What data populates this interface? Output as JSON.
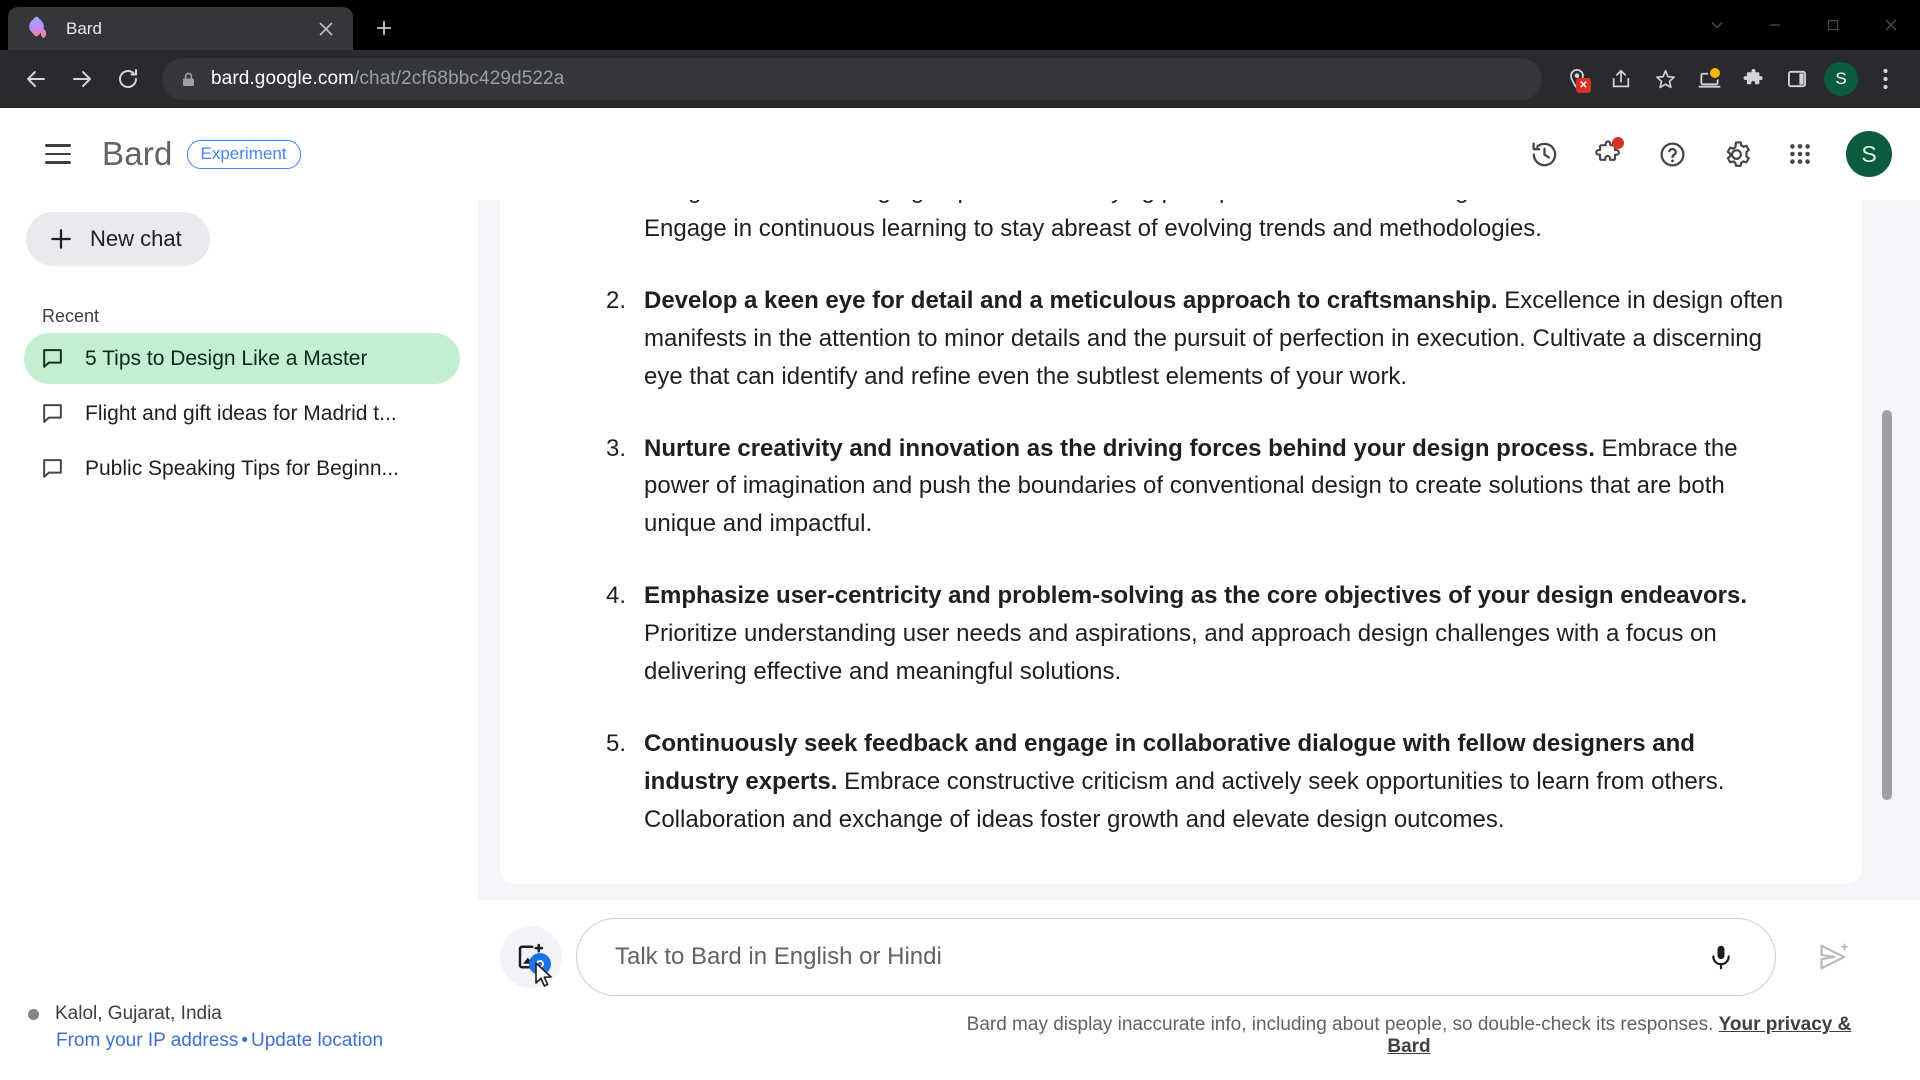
{
  "browser": {
    "tab": {
      "title": "Bard",
      "favicon": "bard-sparkle-icon",
      "close": "×"
    },
    "new_tab_label": "+",
    "window_controls": [
      "tab-search-chevron",
      "minimize",
      "maximize",
      "close"
    ],
    "nav": {
      "back": "back-arrow-icon",
      "forward": "forward-arrow-icon",
      "reload": "reload-icon"
    },
    "omnibox": {
      "lock": "lock-icon",
      "domain": "bard.google.com",
      "path": "/chat/2cf68bbc429d522a",
      "full_url": "bard.google.com/chat/2cf68bbc429d522a"
    },
    "toolbar_icons": [
      "location-blocked-icon",
      "share-icon",
      "bookmark-star-icon",
      "cast-laptop-icon",
      "extensions-puzzle-icon",
      "side-panel-icon"
    ],
    "profile_initial": "S",
    "menu": "three-dot-menu-icon",
    "colors": {
      "tabstrip": "#000000",
      "toolbar": "#292a2d",
      "tab_active": "#35363a",
      "omnibox": "#35363a"
    }
  },
  "header": {
    "menu_icon": "hamburger-icon",
    "brand": "Bard",
    "experiment_badge": "Experiment",
    "icons": [
      "history-icon",
      "extensions-icon",
      "help-icon",
      "settings-icon",
      "google-apps-icon"
    ],
    "extensions_has_notification": true,
    "avatar_initial": "S",
    "accent_blue": "#4285f4",
    "avatar_color": "#0b5c3e"
  },
  "sidebar": {
    "new_chat": "New chat",
    "recent_label": "Recent",
    "chats": [
      {
        "title": "5 Tips to Design Like a Master",
        "active": true
      },
      {
        "title": "Flight and gift ideas for Madrid t...",
        "active": false
      },
      {
        "title": "Public Speaking Tips for Beginn...",
        "active": false
      }
    ],
    "active_bg": "#c4eed0",
    "location": {
      "place": "Kalol, Gujarat, India",
      "source": "From your IP address",
      "separator": "•",
      "update": "Update location",
      "link_color": "#3c6fd4"
    }
  },
  "conversation": {
    "partial_top": "design lies in a thorough grasp of the underlying principles and theories that govern visual communication. Engage in continuous learning to stay abreast of evolving trends and methodologies.",
    "tips": [
      {
        "number": "2.",
        "bold": "Develop a keen eye for detail and a meticulous approach to craftsmanship.",
        "rest": " Excellence in design often manifests in the attention to minor details and the pursuit of perfection in execution. Cultivate a discerning eye that can identify and refine even the subtlest elements of your work."
      },
      {
        "number": "3.",
        "bold": "Nurture creativity and innovation as the driving forces behind your design process.",
        "rest": " Embrace the power of imagination and push the boundaries of conventional design to create solutions that are both unique and impactful."
      },
      {
        "number": "4.",
        "bold": "Emphasize user-centricity and problem-solving as the core objectives of your design endeavors.",
        "rest": " Prioritize understanding user needs and aspirations, and approach design challenges with a focus on delivering effective and meaningful solutions."
      },
      {
        "number": "5.",
        "bold": "Continuously seek feedback and engage in collaborative dialogue with fellow designers and industry experts.",
        "rest": " Embrace constructive criticism and actively seek opportunities to learn from others. Collaboration and exchange of ideas foster growth and elevate design outcomes."
      }
    ]
  },
  "composer": {
    "add_image_icon": "add-image-lens-icon",
    "placeholder": "Talk to Bard in English or Hindi",
    "value": "",
    "mic_icon": "microphone-icon",
    "send_icon": "send-icon"
  },
  "footer": {
    "disclaimer": "Bard may display inaccurate info, including about people, so double-check its responses.",
    "link": "Your privacy & Bard"
  }
}
